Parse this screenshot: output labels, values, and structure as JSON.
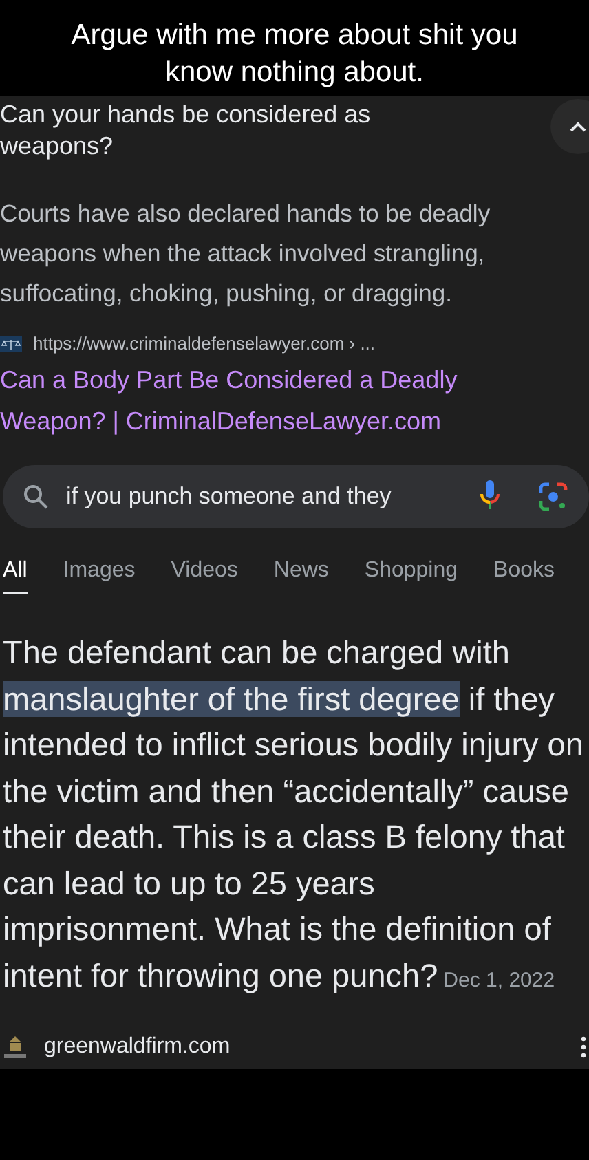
{
  "caption": "Argue with me more about shit you know nothing about.",
  "result": {
    "question": "Can your hands be considered as weapons?",
    "expanded": true,
    "snippet": "Courts have also declared hands to be deadly weapons when the attack involved strangling, suffocating, choking, pushing, or dragging.",
    "url": "https://www.criminaldefenselawyer.com › ...",
    "title": "Can a Body Part Be Considered a Deadly Weapon? | CriminalDefenseLawyer.com"
  },
  "search": {
    "value": "if you punch someone and they"
  },
  "tabs": [
    {
      "label": "All",
      "selected": true
    },
    {
      "label": "Images",
      "selected": false
    },
    {
      "label": "Videos",
      "selected": false
    },
    {
      "label": "News",
      "selected": false
    },
    {
      "label": "Shopping",
      "selected": false
    },
    {
      "label": "Books",
      "selected": false
    }
  ],
  "answer": {
    "segments": [
      {
        "text": "The defendant can be charged with ",
        "highlighted": false
      },
      {
        "text": "manslaughter of the first degree",
        "highlighted": true
      },
      {
        "text": " if they intended to inflict serious bodily injury on the victim and then “accidentally” cause their death. This is a class B felony that can lead to up to 25 years imprisonment. What is the definition of intent for throwing one punch?",
        "highlighted": false
      }
    ],
    "date": "Dec 1, 2022",
    "source": "greenwaldfirm.com"
  }
}
